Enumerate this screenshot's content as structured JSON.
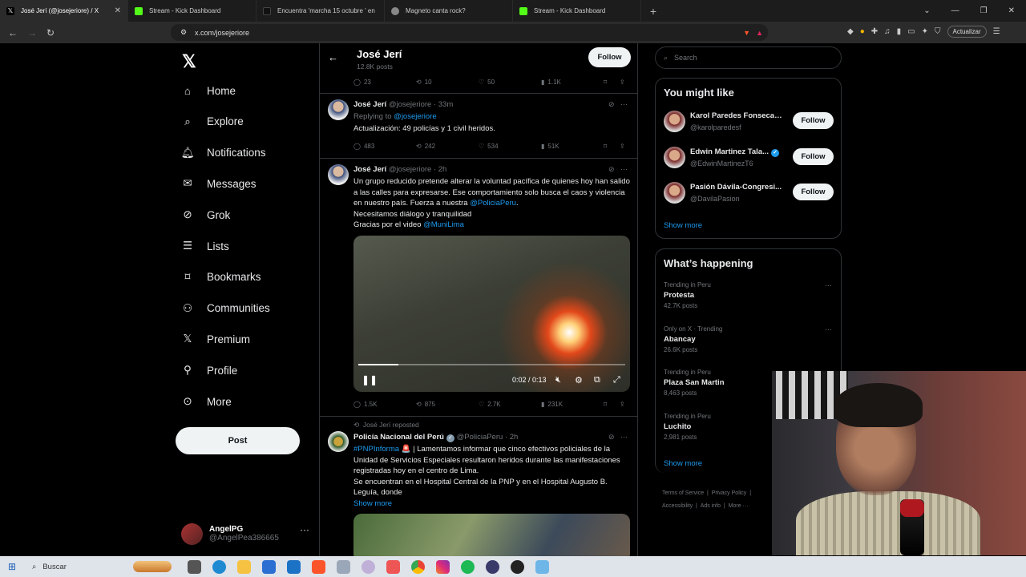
{
  "browser": {
    "tabs": [
      {
        "title": "José Jerí (@josejeriore) / X",
        "active": true,
        "favicon_color": "#000000"
      },
      {
        "title": "Stream - Kick Dashboard",
        "active": false,
        "favicon_color": "#53fc18"
      },
      {
        "title": "Encuentra 'marcha 15 octubre ' en",
        "active": false,
        "favicon_color": "#111111"
      },
      {
        "title": "Magneto canta rock?",
        "active": false,
        "favicon_color": "#888888"
      },
      {
        "title": "Stream - Kick Dashboard",
        "active": false,
        "favicon_color": "#53fc18"
      }
    ],
    "url": "x.com/josejeriore",
    "update_label": "Actualizar"
  },
  "leftnav": {
    "items": [
      {
        "label": "Home",
        "icon": "home-icon"
      },
      {
        "label": "Explore",
        "icon": "search-icon"
      },
      {
        "label": "Notifications",
        "icon": "bell-icon"
      },
      {
        "label": "Messages",
        "icon": "mail-icon"
      },
      {
        "label": "Grok",
        "icon": "grok-icon"
      },
      {
        "label": "Lists",
        "icon": "list-icon"
      },
      {
        "label": "Bookmarks",
        "icon": "bookmark-icon"
      },
      {
        "label": "Communities",
        "icon": "people-icon"
      },
      {
        "label": "Premium",
        "icon": "x-icon"
      },
      {
        "label": "Profile",
        "icon": "person-icon"
      },
      {
        "label": "More",
        "icon": "more-circle-icon"
      }
    ],
    "post_label": "Post",
    "account": {
      "name": "AngelPG",
      "handle": "@AngelPea386665"
    }
  },
  "profile_header": {
    "name": "José Jerí",
    "posts": "12.8K posts",
    "follow_label": "Follow"
  },
  "tweets": [
    {
      "stats": {
        "replies": "23",
        "reposts": "10",
        "likes": "50",
        "views": "1.1K"
      }
    },
    {
      "name": "José Jerí",
      "handle": "@josejeriore",
      "time": "· 33m",
      "reply_prefix": "Replying to ",
      "reply_to": "@josejeriore",
      "text": "Actualización: 49 policías y 1 civil heridos.",
      "stats": {
        "replies": "483",
        "reposts": "242",
        "likes": "534",
        "views": "51K"
      }
    },
    {
      "name": "José Jerí",
      "handle": "@josejeriore",
      "time": "· 2h",
      "text1": "Un grupo reducido pretende alterar la voluntad pacífica de quienes hoy han salido a las calles para expresarse.  Ese comportamiento solo busca el caos y violencia en nuestro país. Fuerza a nuestra ",
      "mention1": "@PoliciaPeru",
      "text1_end": ".",
      "text2": "Necesitamos diálogo y tranquilidad",
      "text3": "Gracias por el video ",
      "mention2": "@MuniLima",
      "video": {
        "time": "0:02 / 0:13",
        "progress": 0.15
      },
      "stats": {
        "replies": "1.5K",
        "reposts": "875",
        "likes": "2.7K",
        "views": "231K"
      }
    },
    {
      "repost_label": "José Jerí reposted",
      "name": "Policía Nacional del Perú",
      "handle": "@PoliciaPeru",
      "time": "· 2h",
      "hashtag": "#PNPInforma",
      "text1": " 🚨 | Lamentamos informar que cinco efectivos policiales de la Unidad de Servicios Especiales resultaron heridos durante las manifestaciones registradas hoy en el centro de Lima.",
      "text2": "Se encuentran en el Hospital Central de la PNP y en el Hospital Augusto B. Leguía, donde",
      "show_more": "Show more"
    }
  ],
  "right": {
    "search_placeholder": "Search",
    "might_like_title": "You might like",
    "suggestions": [
      {
        "name": "Karol Paredes Fonseca",
        "handle": "@karolparedesf",
        "verified": true
      },
      {
        "name": "Edwin Martinez Tala...",
        "handle": "@EdwinMartinezT6",
        "verified": true
      },
      {
        "name": "Pasión Dávila-Congresi...",
        "handle": "@DavilaPasion",
        "verified": false
      }
    ],
    "follow_label": "Follow",
    "show_more": "Show more",
    "happening_title": "What’s happening",
    "trends": [
      {
        "context": "Trending in Peru",
        "name": "Protesta",
        "posts": "42.7K posts"
      },
      {
        "context": "Only on X · Trending",
        "name": "Abancay",
        "posts": "26.6K posts"
      },
      {
        "context": "Trending in Peru",
        "name": "Plaza San Martin",
        "posts": "8,463 posts"
      },
      {
        "context": "Trending in Peru",
        "name": "Luchito",
        "posts": "2,981 posts"
      }
    ],
    "footer": {
      "terms": "Terms of Service",
      "privacy": "Privacy Policy",
      "accessibility": "Accessibility",
      "ads": "Ads info",
      "more": "More ···"
    }
  },
  "taskbar": {
    "search_label": "Buscar"
  }
}
